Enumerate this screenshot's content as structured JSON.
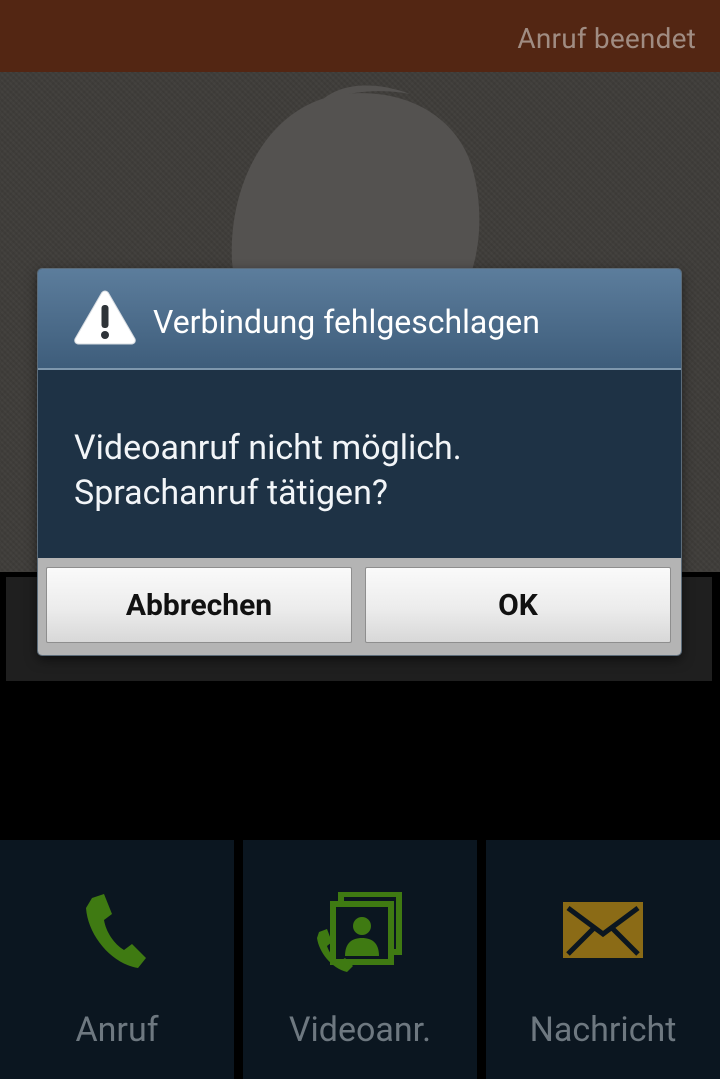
{
  "status_bar": {
    "text": "Anruf beendet",
    "background": "#532613"
  },
  "caller": {
    "photo_icon": "person-silhouette-icon"
  },
  "dialog": {
    "icon": "warning-icon",
    "title": "Verbindung fehlgeschlagen",
    "message_line1": "Videoanruf nicht möglich.",
    "message_line2": "Sprachanruf tätigen?",
    "cancel_label": "Abbrechen",
    "ok_label": "OK",
    "header_color": "#4a6a89",
    "body_color": "#1e3245"
  },
  "actions": [
    {
      "label": "Anruf",
      "icon": "phone-icon",
      "icon_color": "#3f7a12"
    },
    {
      "label": "Videoanr.",
      "icon": "video-call-icon",
      "icon_color": "#3f7a12"
    },
    {
      "label": "Nachricht",
      "icon": "envelope-icon",
      "icon_color": "#8b6b16"
    }
  ]
}
